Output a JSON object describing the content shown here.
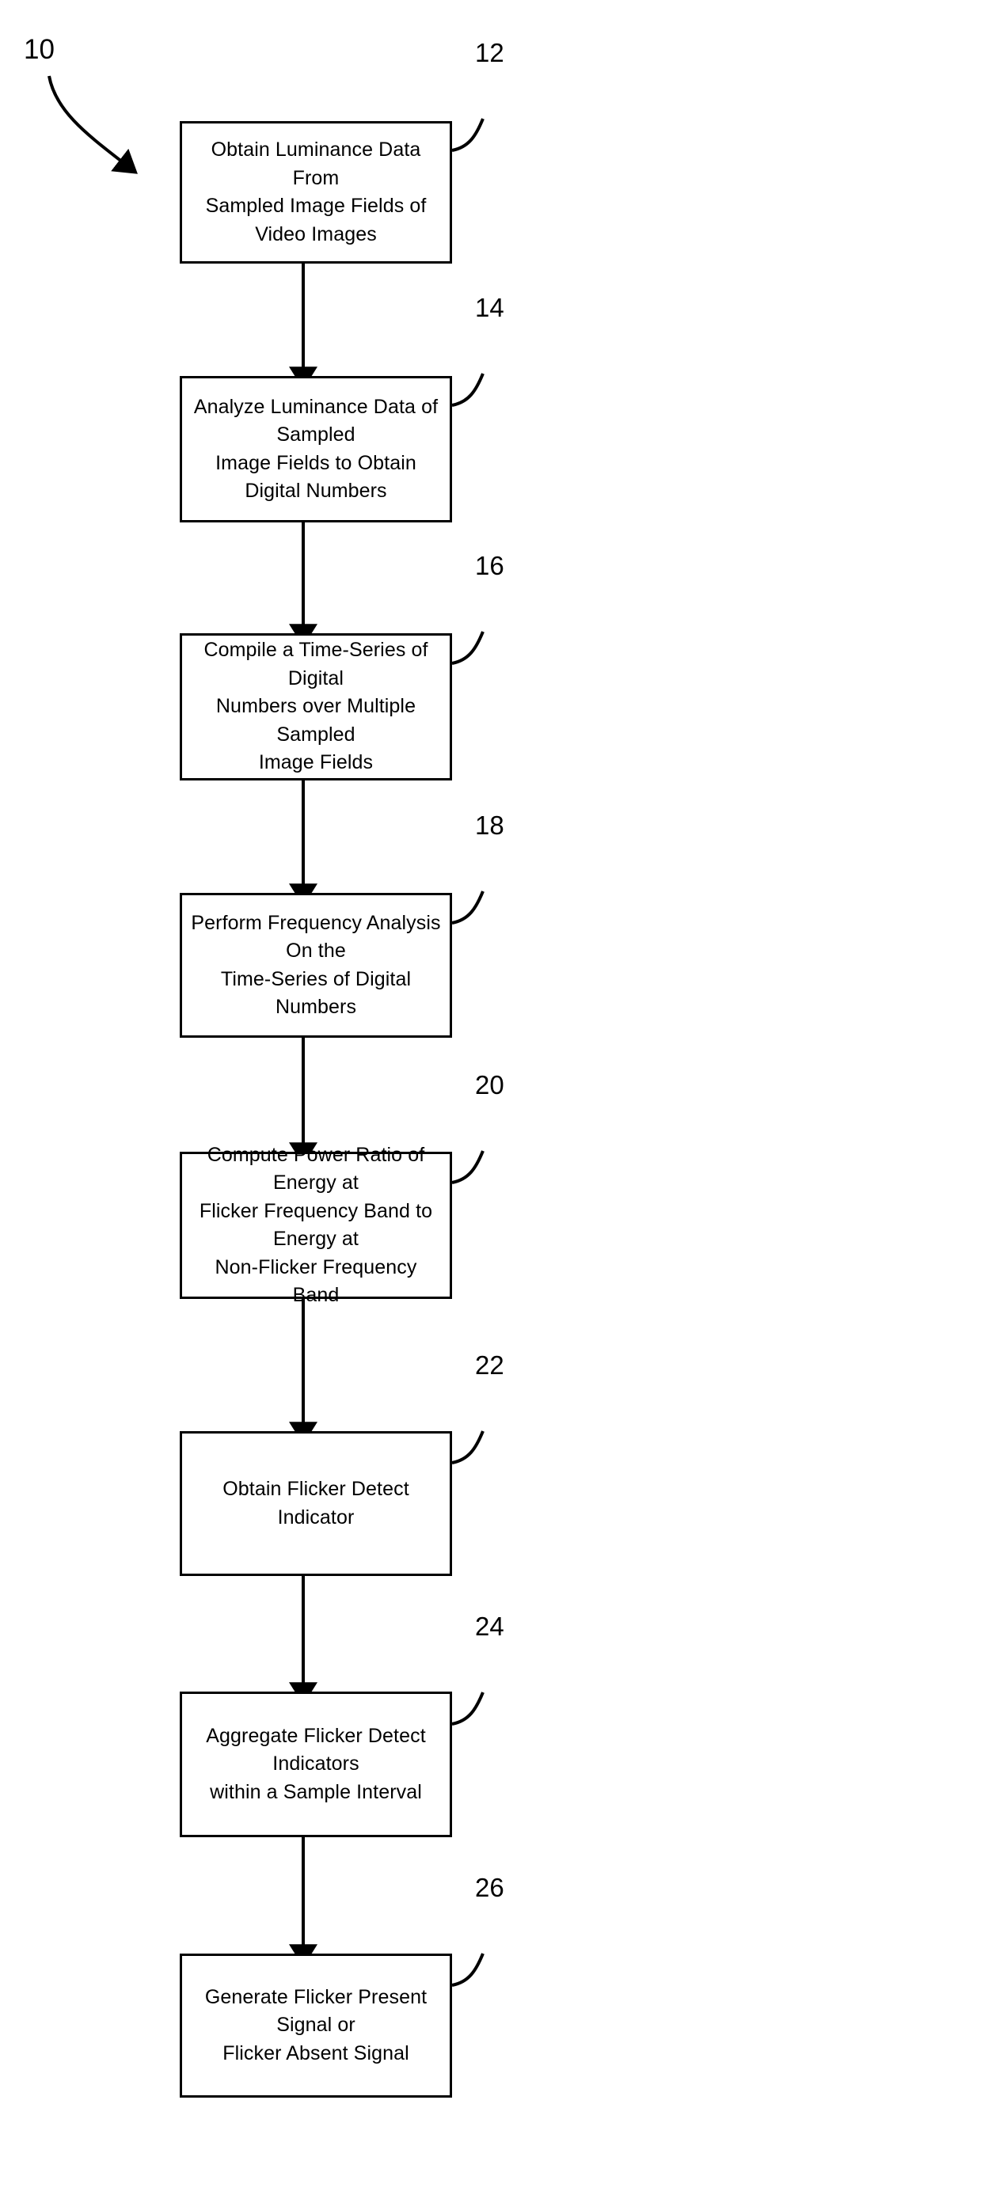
{
  "figure": {
    "figure_label": "10",
    "background_color": "#ffffff",
    "line_color": "#000000",
    "steps": [
      {
        "ref": "12",
        "text": "Obtain Luminance Data From\nSampled Image Fields of Video Images",
        "name": "obtain-luminance-data"
      },
      {
        "ref": "14",
        "text": "Analyze Luminance Data of Sampled\nImage Fields to Obtain Digital Numbers",
        "name": "analyze-luminance-data"
      },
      {
        "ref": "16",
        "text": "Compile a Time-Series of Digital\nNumbers over Multiple Sampled\nImage Fields",
        "name": "compile-time-series"
      },
      {
        "ref": "18",
        "text": "Perform Frequency Analysis On the\nTime-Series of Digital Numbers",
        "name": "perform-frequency-analysis"
      },
      {
        "ref": "20",
        "text": "Compute Power Ratio of Energy at\nFlicker Frequency Band to Energy at\nNon-Flicker Frequency Band",
        "name": "compute-power-ratio"
      },
      {
        "ref": "22",
        "text": "Obtain Flicker Detect Indicator",
        "name": "obtain-flicker-detect-indicator"
      },
      {
        "ref": "24",
        "text": "Aggregate Flicker Detect Indicators\nwithin a Sample Interval",
        "name": "aggregate-flicker-detect-indicators"
      },
      {
        "ref": "26",
        "text": "Generate Flicker Present Signal or\nFlicker Absent Signal",
        "name": "generate-flicker-signal"
      }
    ]
  }
}
